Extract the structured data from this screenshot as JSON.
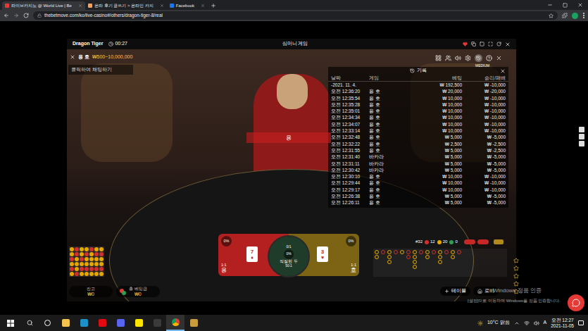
{
  "browser": {
    "tabs": [
      {
        "label": "라이브카지노 @ World Live | Be",
        "selected": true,
        "color": "#e53935"
      },
      {
        "label": "온라 후기 글쓰기 > 온라인 카지",
        "selected": false,
        "color": "#f4a261"
      },
      {
        "label": "Facebook",
        "selected": false,
        "color": "#1877f2"
      }
    ],
    "url": "thebetmove.com/ko/live-casino#/others/dragon-tiger-8/real"
  },
  "game": {
    "title": "Dragon Tiger",
    "timer": "00:27",
    "header": "심머니 게임",
    "table_label": "용 호",
    "limits": "₩500~10,000,000",
    "chat": "클릭하여 채팅하기",
    "quality": "MEDIUM",
    "result_banner": "용"
  },
  "history": {
    "title": "기록",
    "columns": [
      "날짜",
      "게임",
      "베팅",
      "승리/패배"
    ],
    "rows": [
      {
        "date": "-2021. 11. 4.",
        "game": "",
        "bet": "₩ 192,500",
        "result": "₩ -10,000"
      },
      {
        "date": "오전 12:36:20",
        "game": "용 호",
        "bet": "₩ 20,000",
        "result": "₩ -20,000"
      },
      {
        "date": "오전 12:35:54",
        "game": "용 호",
        "bet": "₩ 10,000",
        "result": "₩ -10,000"
      },
      {
        "date": "오전 12:35:28",
        "game": "용 호",
        "bet": "₩ 10,000",
        "result": "₩ -10,000"
      },
      {
        "date": "오전 12:35:01",
        "game": "용 호",
        "bet": "₩ 10,000",
        "result": "₩ -10,000"
      },
      {
        "date": "오전 12:34:34",
        "game": "용 호",
        "bet": "₩ 10,000",
        "result": "₩ -10,000"
      },
      {
        "date": "오전 12:34:07",
        "game": "용 호",
        "bet": "₩ 10,000",
        "result": "₩ -10,000"
      },
      {
        "date": "오전 12:33:14",
        "game": "용 호",
        "bet": "₩ 10,000",
        "result": "₩ -10,000"
      },
      {
        "date": "오전 12:32:48",
        "game": "용 호",
        "bet": "₩ 5,000",
        "result": "₩ -5,000"
      },
      {
        "date": "오전 12:32:22",
        "game": "용 호",
        "bet": "₩ 2,500",
        "result": "₩ -2,500"
      },
      {
        "date": "오전 12:31:55",
        "game": "용 호",
        "bet": "₩ 5,000",
        "result": "₩ -2,500"
      },
      {
        "date": "오전 12:31:40",
        "game": "바카라",
        "bet": "₩ 5,000",
        "result": "₩ -5,000"
      },
      {
        "date": "오전 12:31:11",
        "game": "바카라",
        "bet": "₩ 5,000",
        "result": "₩ -5,000"
      },
      {
        "date": "오전 12:30:42",
        "game": "바카라",
        "bet": "₩ 5,000",
        "result": "₩ -5,000"
      },
      {
        "date": "오전 12:30:10",
        "game": "용 호",
        "bet": "₩ 10,000",
        "result": "₩ -10,000"
      },
      {
        "date": "오전 12:29:44",
        "game": "용 호",
        "bet": "₩ 10,000",
        "result": "₩ -10,000"
      },
      {
        "date": "오전 12:29:17",
        "game": "용 호",
        "bet": "₩ 10,000",
        "result": "₩ -10,000"
      },
      {
        "date": "오전 12:26:38",
        "game": "용 호",
        "bet": "₩ 5,000",
        "result": "₩ -5,000"
      },
      {
        "date": "오전 12:26:11",
        "game": "용 호",
        "bet": "₩ 5,000",
        "result": "₩ -5,000"
      }
    ]
  },
  "bet_spots": [
    {
      "name": "용",
      "payout": "1:1",
      "percent": "0%",
      "card": "7",
      "suit": "♦",
      "color": "#b3201f"
    },
    {
      "name": "호",
      "payout": "1:1",
      "percent": "0%",
      "card": "3",
      "suit": "♥",
      "color": "#7d6414"
    }
  ],
  "tie": {
    "count": "0/1",
    "percent": "0%",
    "label": "적절한 두",
    "payout": "50:1"
  },
  "road_stats": {
    "total": "#32",
    "counts": [
      {
        "value": "12",
        "color": "#d32f2f"
      },
      {
        "value": "20",
        "color": "#e6a800"
      },
      {
        "value": "0",
        "color": "#2e9e4f"
      }
    ]
  },
  "bead_road": [
    "#e6a800",
    "#e6a800",
    "#d32f2f",
    "#e6a800",
    "#d32f2f",
    "#e6a800",
    "#d32f2f",
    "#d32f2f",
    "#e6a800",
    "#e6a800",
    "#e6a800",
    "#d32f2f",
    "#e6a800",
    "#e6a800",
    "#d32f2f",
    "#e6a800",
    "#d32f2f",
    "#e6a800",
    "#e6a800",
    "#d32f2f",
    "#e6a800",
    "#e6a800",
    "#d32f2f",
    "#e6a800",
    "#d32f2f",
    "#e6a800",
    "#e6a800",
    "#e6a800",
    "#d32f2f",
    "#e6a800",
    "#e6a800",
    "#d32f2f",
    "#e6a800",
    "#e6a800",
    "#d32f2f",
    "#e6a800",
    "#e6a800",
    "#d32f2f",
    "#e6a800",
    "#e6a800",
    "#d32f2f",
    "#e6a800"
  ],
  "big_road": [
    {
      "color": "#e6a800",
      "count": 2
    },
    {
      "color": "#d32f2f",
      "count": 1
    },
    {
      "color": "#e6a800",
      "count": 3
    },
    {
      "color": "#d32f2f",
      "count": 1
    },
    {
      "color": "#e6a800",
      "count": 1
    },
    {
      "color": "#d32f2f",
      "count": 2
    },
    {
      "color": "#e6a800",
      "count": 4
    },
    {
      "color": "#d32f2f",
      "count": 1
    },
    {
      "color": "#e6a800",
      "count": 2
    },
    {
      "color": "#d32f2f",
      "count": 1
    },
    {
      "color": "#e6a800",
      "count": 3
    },
    {
      "color": "#d32f2f",
      "count": 1
    },
    {
      "color": "#e6a800",
      "count": 2
    },
    {
      "color": "#d32f2f",
      "count": 1
    }
  ],
  "balance": {
    "label": "잔고",
    "value": "₩0"
  },
  "total_bet": {
    "label": "총 베팅금",
    "value": "₩0"
  },
  "buttons": [
    {
      "label": "테이블"
    },
    {
      "label": "로비"
    }
  ],
  "watermark": {
    "title": "Windows 정품 인증",
    "subtitle": "[설정]으로 이동하여 Windows를 정품 인증합니다."
  },
  "side_stars": 5,
  "taskbar": {
    "weather": "10°C 맑음",
    "ime": "A",
    "time": "오전 12:27",
    "date": "2021-11-05"
  }
}
